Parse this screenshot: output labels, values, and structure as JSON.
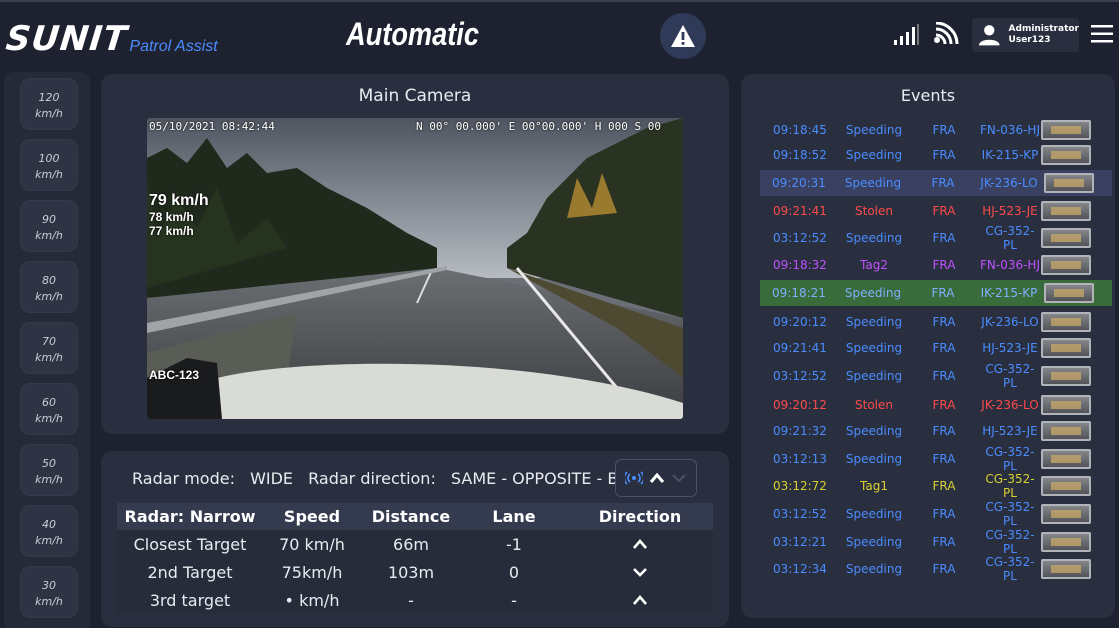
{
  "header": {
    "logo_main": "SUNIT",
    "logo_sub": "Patrol Assist",
    "mode": "Automatic",
    "user": {
      "role": "Administrator",
      "name": "User123"
    }
  },
  "speed_limits": [
    {
      "value": "120",
      "unit": "km/h"
    },
    {
      "value": "100",
      "unit": "km/h"
    },
    {
      "value": "90",
      "unit": "km/h"
    },
    {
      "value": "80",
      "unit": "km/h"
    },
    {
      "value": "70",
      "unit": "km/h"
    },
    {
      "value": "60",
      "unit": "km/h"
    },
    {
      "value": "50",
      "unit": "km/h"
    },
    {
      "value": "40",
      "unit": "km/h"
    },
    {
      "value": "30",
      "unit": "km/h"
    }
  ],
  "camera": {
    "title": "Main Camera",
    "timestamp": "05/10/2021 08:42:44",
    "gps": "N 00° 00.000' E 00°00.000' H 000 S 00",
    "speed_main": "79 km/h",
    "speed_2": "78 km/h",
    "speed_3": "77 km/h",
    "plate": "ABC-123"
  },
  "radar": {
    "mode_label": "Radar mode:",
    "mode_value": "WIDE",
    "direction_label": "Radar direction:",
    "direction_value": "SAME - OPPOSITE - BOTH",
    "columns": [
      "Radar: Narrow",
      "Speed",
      "Distance",
      "Lane",
      "Direction"
    ],
    "rows": [
      {
        "name": "Closest Target",
        "speed": "70 km/h",
        "distance": "66m",
        "lane": "-1",
        "direction": "up"
      },
      {
        "name": "2nd Target",
        "speed": "75km/h",
        "distance": "103m",
        "lane": "0",
        "direction": "down"
      },
      {
        "name": "3rd target",
        "speed": "•  km/h",
        "distance": "-",
        "lane": "-",
        "direction": "up"
      }
    ]
  },
  "events": {
    "title": "Events",
    "rows": [
      {
        "time": "09:18:45",
        "type": "Speeding",
        "country": "FRA",
        "plate": "FN-036-HJ",
        "color": "#4a8cff",
        "bg": ""
      },
      {
        "time": "09:18:52",
        "type": "Speeding",
        "country": "FRA",
        "plate": "IK-215-KP",
        "color": "#4a8cff",
        "bg": ""
      },
      {
        "time": "09:20:31",
        "type": "Speeding",
        "country": "FRA",
        "plate": "JK-236-LO",
        "color": "#4a8cff",
        "bg": "#3a4160"
      },
      {
        "time": "09:21:41",
        "type": "Stolen",
        "country": "FRA",
        "plate": "HJ-523-JE",
        "color": "#ff4a4a",
        "bg": ""
      },
      {
        "time": "03:12:52",
        "type": "Speeding",
        "country": "FRA",
        "plate": "CG-352-PL",
        "color": "#4a8cff",
        "bg": ""
      },
      {
        "time": "09:18:32",
        "type": "Tag2",
        "country": "FRA",
        "plate": "FN-036-HJ",
        "color": "#c050ff",
        "bg": ""
      },
      {
        "time": "09:18:21",
        "type": "Speeding",
        "country": "FRA",
        "plate": "IK-215-KP",
        "color": "#4a8cff",
        "bg": "#3a6b3a"
      },
      {
        "time": "09:20:12",
        "type": "Speeding",
        "country": "FRA",
        "plate": "JK-236-LO",
        "color": "#4a8cff",
        "bg": ""
      },
      {
        "time": "09:21:41",
        "type": "Speeding",
        "country": "FRA",
        "plate": "HJ-523-JE",
        "color": "#4a8cff",
        "bg": ""
      },
      {
        "time": "03:12:52",
        "type": "Speeding",
        "country": "FRA",
        "plate": "CG-352-PL",
        "color": "#4a8cff",
        "bg": ""
      },
      {
        "time": "09:20:12",
        "type": "Stolen",
        "country": "FRA",
        "plate": "JK-236-LO",
        "color": "#ff4a4a",
        "bg": ""
      },
      {
        "time": "09:21:32",
        "type": "Speeding",
        "country": "FRA",
        "plate": "HJ-523-JE",
        "color": "#4a8cff",
        "bg": ""
      },
      {
        "time": "03:12:13",
        "type": "Speeding",
        "country": "FRA",
        "plate": "CG-352-PL",
        "color": "#4a8cff",
        "bg": ""
      },
      {
        "time": "03:12:72",
        "type": "Tag1",
        "country": "FRA",
        "plate": "CG-352-PL",
        "color": "#d8d030",
        "bg": ""
      },
      {
        "time": "03:12:52",
        "type": "Speeding",
        "country": "FRA",
        "plate": "CG-352-PL",
        "color": "#4a8cff",
        "bg": ""
      },
      {
        "time": "03:12:21",
        "type": "Speeding",
        "country": "FRA",
        "plate": "CG-352-PL",
        "color": "#4a8cff",
        "bg": ""
      },
      {
        "time": "03:12:34",
        "type": "Speeding",
        "country": "FRA",
        "plate": "CG-352-PL",
        "color": "#4a8cff",
        "bg": ""
      }
    ]
  }
}
